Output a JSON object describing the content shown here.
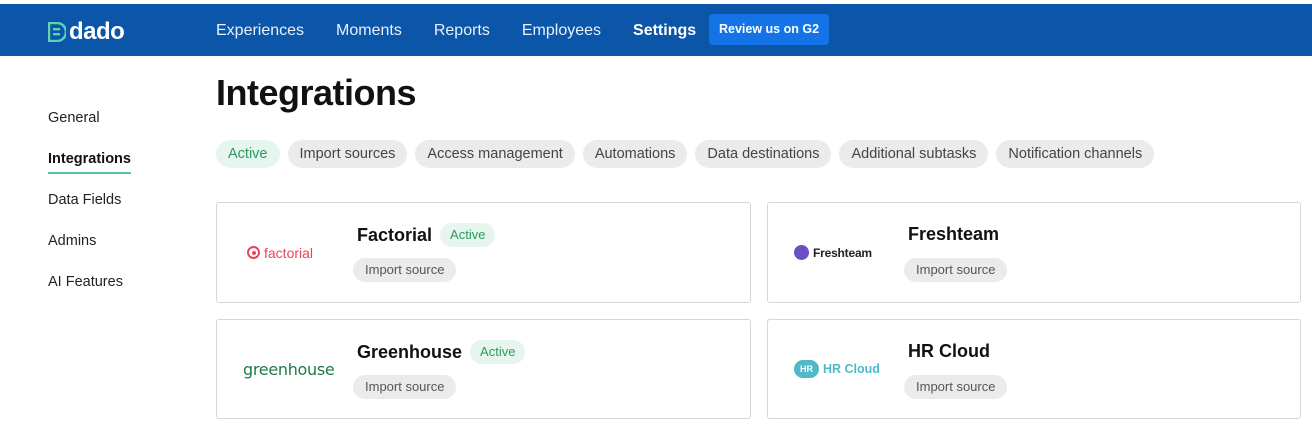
{
  "brand": {
    "name": "dado",
    "logo_icon": "dado-logo-icon"
  },
  "nav": {
    "items": [
      {
        "label": "Experiences",
        "current": false
      },
      {
        "label": "Moments",
        "current": false
      },
      {
        "label": "Reports",
        "current": false
      },
      {
        "label": "Employees",
        "current": false
      },
      {
        "label": "Settings",
        "current": true
      }
    ],
    "g2_button": "Review us on G2"
  },
  "sidebar": {
    "items": [
      {
        "label": "General",
        "active": false
      },
      {
        "label": "Integrations",
        "active": true
      },
      {
        "label": "Data Fields",
        "active": false
      },
      {
        "label": "Admins",
        "active": false
      },
      {
        "label": "AI Features",
        "active": false
      }
    ]
  },
  "page": {
    "title": "Integrations"
  },
  "filters": [
    {
      "label": "Active",
      "selected": true
    },
    {
      "label": "Import sources",
      "selected": false
    },
    {
      "label": "Access management",
      "selected": false
    },
    {
      "label": "Automations",
      "selected": false
    },
    {
      "label": "Data destinations",
      "selected": false
    },
    {
      "label": "Additional subtasks",
      "selected": false
    },
    {
      "label": "Notification channels",
      "selected": false
    }
  ],
  "integrations": [
    {
      "name": "Factorial",
      "logo_text": "factorial",
      "status": "Active",
      "tag": "Import source"
    },
    {
      "name": "Freshteam",
      "logo_text": "Freshteam",
      "status": "",
      "tag": "Import source"
    },
    {
      "name": "Greenhouse",
      "logo_text": "greenhouse",
      "status": "Active",
      "tag": "Import source"
    },
    {
      "name": "HR Cloud",
      "logo_text": "HR Cloud",
      "logo_badge": "HR",
      "status": "",
      "tag": "Import source"
    }
  ],
  "colors": {
    "header_bg": "#0b56a8",
    "g2_button_bg": "#1473e6",
    "active_green": "#2e9a62",
    "active_bg": "#e6f5ed",
    "sidebar_underline": "#5dc39a"
  }
}
